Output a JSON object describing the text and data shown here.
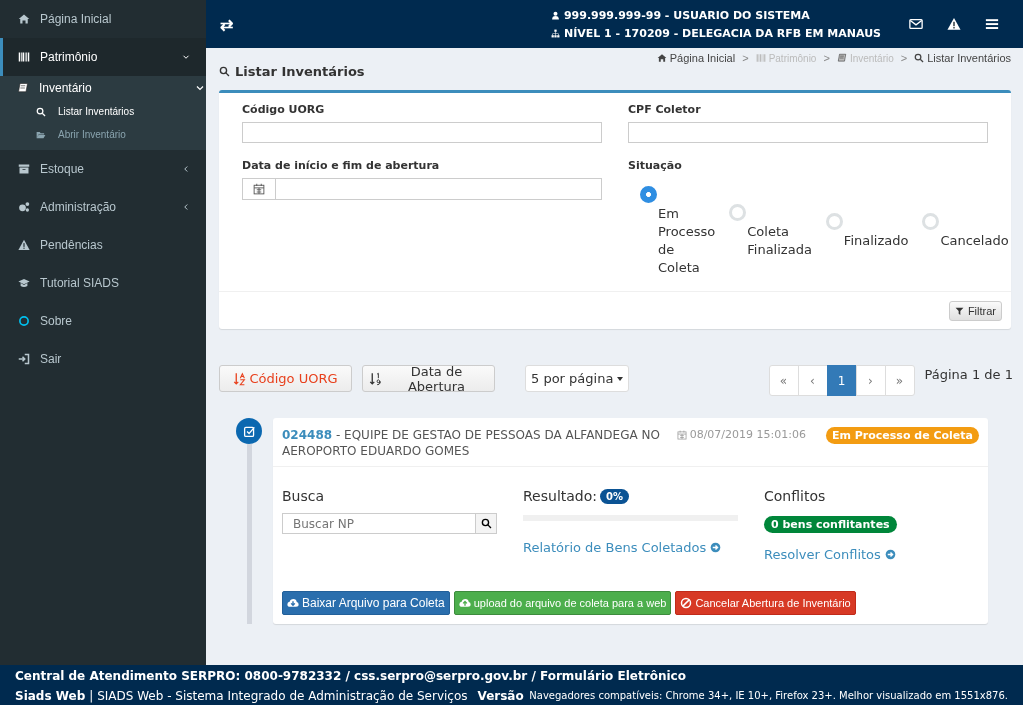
{
  "sidebar": {
    "items": [
      {
        "label": "Página Inicial",
        "selected": false
      },
      {
        "label": "Patrimônio",
        "selected": true,
        "expanded": true,
        "children": [
          {
            "label": "Inventário",
            "expanded": true,
            "children": [
              {
                "label": "Listar Inventários",
                "selected": true
              },
              {
                "label": "Abrir Inventário",
                "selected": false
              }
            ]
          }
        ]
      },
      {
        "label": "Estoque",
        "selected": false,
        "expanded": false
      },
      {
        "label": "Administração",
        "selected": false,
        "expanded": false
      },
      {
        "label": "Pendências",
        "selected": false
      },
      {
        "label": "Tutorial SIADS",
        "selected": false
      },
      {
        "label": "Sobre",
        "selected": false
      },
      {
        "label": "Sair",
        "selected": false
      }
    ]
  },
  "header": {
    "toggle": "⇄",
    "user": "999.999.999-99 - USUARIO DO SISTEMA",
    "unit": "NÍVEL 1 - 170209 - DELEGACIA DA RFB EM MANAUS"
  },
  "page_title": "Listar Inventários",
  "breadcrumb": {
    "separator": ">",
    "items": [
      {
        "label": "Página Inicial",
        "disabled": false
      },
      {
        "label": "Patrimônio",
        "disabled": true
      },
      {
        "label": "Inventário",
        "disabled": true
      },
      {
        "label": "Listar Inventários",
        "disabled": false
      }
    ]
  },
  "filter": {
    "uorg_label": "Código UORG",
    "cpf_label": "CPF Coletor",
    "date_label": "Data de início e fim de abertura",
    "situation_label": "Situação",
    "situations": [
      {
        "label": "Em Processo de Coleta",
        "selected": true
      },
      {
        "label": "Coleta Finalizada",
        "selected": false
      },
      {
        "label": "Finalizado",
        "selected": false
      },
      {
        "label": "Cancelado",
        "selected": false
      }
    ],
    "button": "Filtrar"
  },
  "sort_buttons": [
    {
      "label": "Código UORG",
      "selected": true
    },
    {
      "label": "Data de Abertura",
      "selected": false
    }
  ],
  "page_size": "5 por página",
  "pagination": [
    {
      "label": "«",
      "selected": false
    },
    {
      "label": "‹",
      "selected": false
    },
    {
      "label": "1",
      "selected": true
    },
    {
      "label": "›",
      "selected": false
    },
    {
      "label": "»",
      "selected": false
    }
  ],
  "page_info": "Página 1 de 1",
  "inventory": {
    "code": "024488",
    "title": " - EQUIPE DE GESTAO DE PESSOAS DA ALFANDEGA NO AEROPORTO EDUARDO GOMES",
    "date": "08/07/2019 15:01:06",
    "status": "Em Processo de Coleta",
    "search_label": "Busca",
    "search_placeholder": "Buscar NP",
    "result_label": "Resultado:",
    "result_badge": "0%",
    "level": 0,
    "report_link": "Relatório de Bens Coletados",
    "conflicts_label": "Conflitos",
    "conflicts_badge": "0 bens conflitantes",
    "conflicts_link": "Resolver Conflitos",
    "actions": [
      {
        "kind": "primary",
        "label": "Baixar Arquivo para Coleta"
      },
      {
        "kind": "success",
        "label": "upload do arquivo de coleta para a web"
      },
      {
        "kind": "danger",
        "label": "Cancelar Abertura de Inventário"
      }
    ]
  },
  "footer": {
    "contact": "Central de Atendimento SERPRO: 0800-9782332 / css.serpro@serpro.gov.br / Formulário Eletrônico",
    "brand": "Siads Web",
    "system": "| SIADS Web - Sistema Integrado de Administração de Serviços",
    "version": "Versão",
    "browsers": "Navegadores compatíveis: Chrome 34+, IE 10+, Firefox 23+. Melhor visualizado em 1551x876."
  }
}
